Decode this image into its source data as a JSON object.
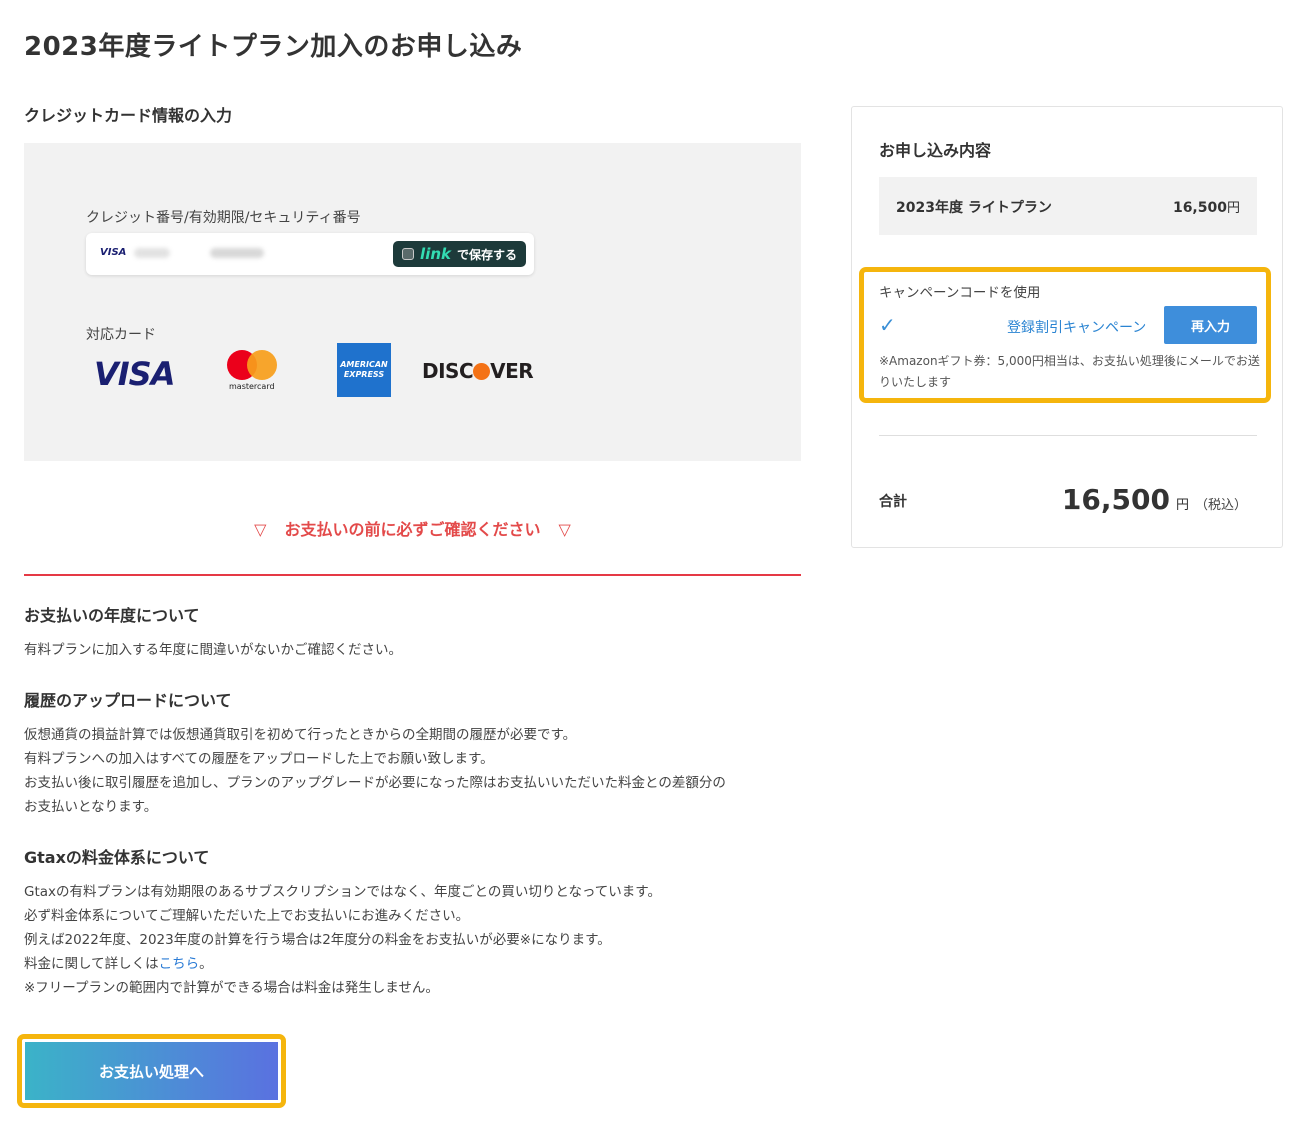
{
  "page": {
    "title": "2023年度ライトプラン加入のお申し込み"
  },
  "card_section": {
    "heading": "クレジットカード情報の入力",
    "field_label": "クレジット番号/有効期限/セキュリティ番号",
    "card_brand": "VISA",
    "link_brand": "link",
    "link_save_text": "で保存する",
    "supported_label": "対応カード",
    "logos": {
      "visa": "VISA",
      "mastercard": "mastercard",
      "amex_line1": "AMERICAN",
      "amex_line2": "EXPRESS",
      "discover_a": "DISC",
      "discover_b": "VER"
    }
  },
  "notice": {
    "triangle": "▽",
    "text": "お支払いの前に必ずご確認ください"
  },
  "info_sections": [
    {
      "heading": "お支払いの年度について",
      "lines": [
        "有料プランに加入する年度に間違いがないかご確認ください。"
      ]
    },
    {
      "heading": "履歴のアップロードについて",
      "lines": [
        "仮想通貨の損益計算では仮想通貨取引を初めて行ったときからの全期間の履歴が必要です。",
        "有料プランへの加入はすべての履歴をアップロードした上でお願い致します。",
        "お支払い後に取引履歴を追加し、プランのアップグレードが必要になった際はお支払いいただいた料金との差額分の",
        "お支払いとなります。"
      ]
    },
    {
      "heading": "Gtaxの料金体系について",
      "lines": [
        "Gtaxの有料プランは有効期限のあるサブスクリプションではなく、年度ごとの買い切りとなっています。",
        "必ず料金体系についてご理解いただいた上でお支払いにお進みください。",
        "例えば2022年度、2023年度の計算を行う場合は2年度分の料金をお支払いが必要※になります。"
      ],
      "link_prefix": "料金に関して詳しくは",
      "link_text": "こちら",
      "link_suffix": "。",
      "footnote": "※フリープランの範囲内で計算ができる場合は料金は発生しません。"
    }
  ],
  "pay_button": {
    "label": "お支払い処理へ"
  },
  "summary": {
    "title": "お申し込み内容",
    "plan_name": "2023年度 ライトプラン",
    "plan_price": "16,500",
    "plan_currency": "円",
    "campaign_label": "キャンペーンコードを使用",
    "campaign_check": "✓",
    "campaign_name": "登録割引キャンペーン",
    "reenter_label": "再入力",
    "campaign_note": "※Amazonギフト券：5,000円相当は、お支払い処理後にメールでお送りいたします",
    "total_label": "合計",
    "total_amount": "16,500",
    "total_currency": "円",
    "total_tax": "（税込）"
  },
  "colors": {
    "accent_blue": "#3e8edb",
    "notice_red": "#e34a4a",
    "highlight_yellow": "#f5b50d",
    "button_gradient_start": "#3bb3c8",
    "button_gradient_end": "#5a71e0"
  }
}
